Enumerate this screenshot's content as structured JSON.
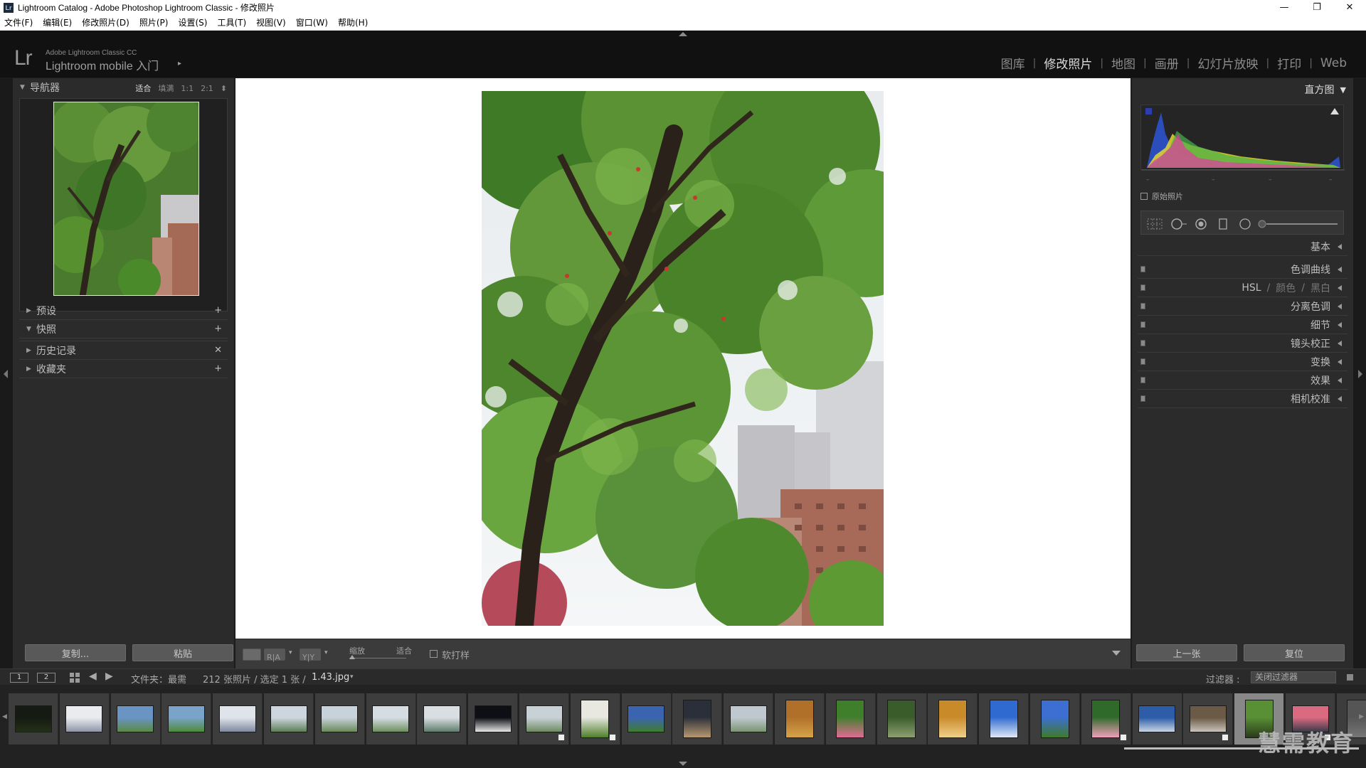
{
  "window": {
    "title": "Lightroom Catalog - Adobe Photoshop Lightroom Classic - 修改照片",
    "app_icon": "Lr",
    "controls": {
      "minimize": "—",
      "restore": "❐",
      "close": "✕"
    }
  },
  "menu": [
    "文件(F)",
    "编辑(E)",
    "修改照片(D)",
    "照片(P)",
    "设置(S)",
    "工具(T)",
    "视图(V)",
    "窗口(W)",
    "帮助(H)"
  ],
  "identity": {
    "logo": "Lr",
    "small": "Adobe Lightroom Classic CC",
    "main": "Lightroom mobile 入门",
    "arrow": "▸"
  },
  "modules": {
    "items": [
      "图库",
      "修改照片",
      "地图",
      "画册",
      "幻灯片放映",
      "打印",
      "Web"
    ],
    "active": "修改照片",
    "separator": "|"
  },
  "navigator": {
    "title": "导航器",
    "zoom_options": [
      "适合",
      "填满",
      "1:1",
      "2:1"
    ],
    "zoom_active": "适合",
    "zoom_stepper": "⬍"
  },
  "left_sections": [
    {
      "label": "预设",
      "state": "collapsed",
      "action": "+"
    },
    {
      "label": "快照",
      "state": "expanded",
      "action": "+"
    },
    {
      "label": "历史记录",
      "state": "collapsed",
      "action": "✕"
    },
    {
      "label": "收藏夹",
      "state": "collapsed",
      "action": "+"
    }
  ],
  "left_buttons": {
    "copy": "复制...",
    "paste": "粘贴"
  },
  "toolbar": {
    "before_after_1": "R|A",
    "before_after_2": "Y|Y",
    "zoom_label": "缩放",
    "zoom_value": "适合",
    "soft_proof": "软打样"
  },
  "histogram": {
    "title": "直方图",
    "original_photo": "原始照片"
  },
  "right_sections": [
    {
      "label": "基本",
      "switch": false
    },
    {
      "label": "色调曲线",
      "switch": true
    },
    {
      "label": "HSL",
      "extra": [
        "颜色",
        "黑白"
      ],
      "switch": true
    },
    {
      "label": "分离色调",
      "switch": true
    },
    {
      "label": "细节",
      "switch": true
    },
    {
      "label": "镜头校正",
      "switch": true
    },
    {
      "label": "变换",
      "switch": true
    },
    {
      "label": "效果",
      "switch": true
    },
    {
      "label": "相机校准",
      "switch": true
    }
  ],
  "right_buttons": {
    "previous": "上一张",
    "reset": "复位"
  },
  "filmstrip_header": {
    "screen1": "1",
    "screen2": "2",
    "source": "文件夹：最需",
    "count": "212 张照片 / 选定 1 张 /",
    "filename": "1.43.jpg",
    "filter_label": "过滤器 :",
    "filter_value": "关闭过滤器"
  },
  "filmstrip": {
    "thumbnails": [
      {
        "kind": "dark-tree"
      },
      {
        "kind": "ferris-wheel"
      },
      {
        "kind": "river-sky"
      },
      {
        "kind": "green-trees"
      },
      {
        "kind": "ferris-wheel-2"
      },
      {
        "kind": "lake-trees"
      },
      {
        "kind": "lake-trees-2"
      },
      {
        "kind": "riverside"
      },
      {
        "kind": "river-bridge"
      },
      {
        "kind": "night-dark"
      },
      {
        "kind": "willow"
      },
      {
        "kind": "potted-plant"
      },
      {
        "kind": "field-sky"
      },
      {
        "kind": "sunset"
      },
      {
        "kind": "willow-2"
      },
      {
        "kind": "autumn-leaves"
      },
      {
        "kind": "pink-flower"
      },
      {
        "kind": "forest-path"
      },
      {
        "kind": "golden-ornament"
      },
      {
        "kind": "blue-sky-tree"
      },
      {
        "kind": "blue-sky-tree-2"
      },
      {
        "kind": "lotus"
      },
      {
        "kind": "city-skyline"
      },
      {
        "kind": "camera-bag"
      },
      {
        "kind": "tree-selected"
      },
      {
        "kind": "pink-sunset"
      },
      {
        "kind": "tree-edge"
      }
    ]
  },
  "watermark": "慧需教育",
  "colors": {
    "module_active": "#dcdcdc",
    "module_inactive": "#8c8c8c",
    "panel_bg": "#2b2b2b",
    "canvas_bg": "#ffffff"
  }
}
